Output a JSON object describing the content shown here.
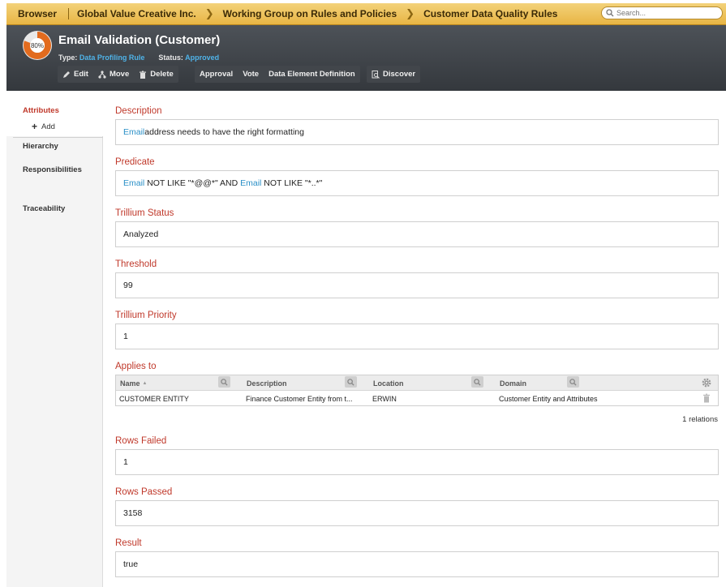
{
  "breadcrumb": {
    "items": [
      "Browser",
      "Global Value Creative Inc.",
      "Working Group on Rules and Policies",
      "Customer Data Quality Rules"
    ]
  },
  "search": {
    "placeholder": "Search..."
  },
  "asset": {
    "score": "80%",
    "score_fraction": 0.8,
    "title": "Email Validation (Customer)",
    "type_label": "Type:",
    "type_value": "Data Profiling Rule",
    "status_label": "Status:",
    "status_value": "Approved"
  },
  "toolbar": {
    "edit": "Edit",
    "move": "Move",
    "delete": "Delete",
    "approval": "Approval",
    "vote": "Vote",
    "ded": "Data Element Definition",
    "discover": "Discover"
  },
  "nav": {
    "attributes": "Attributes",
    "add": "Add",
    "hierarchy": "Hierarchy",
    "responsibilities": "Responsibilities",
    "traceability": "Traceability"
  },
  "fields": {
    "description": {
      "label": "Description",
      "kw": "Email",
      "rest": " address needs to have the right formatting"
    },
    "predicate": {
      "label": "Predicate",
      "kw1": "Email",
      "mid": " NOT LIKE \"*@@*\" AND ",
      "kw2": "Email",
      "end": " NOT LIKE \"*..*\""
    },
    "trillium_status": {
      "label": "Trillium Status",
      "value": "Analyzed"
    },
    "threshold": {
      "label": "Threshold",
      "value": "99"
    },
    "trillium_priority": {
      "label": "Trillium Priority",
      "value": "1"
    },
    "applies_to": {
      "label": "Applies to"
    },
    "rows_failed": {
      "label": "Rows Failed",
      "value": "1"
    },
    "rows_passed": {
      "label": "Rows Passed",
      "value": "3158"
    },
    "result": {
      "label": "Result",
      "value": "true"
    }
  },
  "applies_table": {
    "columns": [
      "Name",
      "Description",
      "Location",
      "Domain"
    ],
    "rows": [
      [
        "CUSTOMER ENTITY",
        "Finance Customer Entity from t...",
        "ERWIN",
        "Customer Entity and Attributes"
      ]
    ],
    "relations": "1 relations"
  },
  "colors": {
    "accent_red": "#c0392b",
    "link_blue": "#2a8fc7",
    "gauge_orange": "#e26b1e"
  }
}
